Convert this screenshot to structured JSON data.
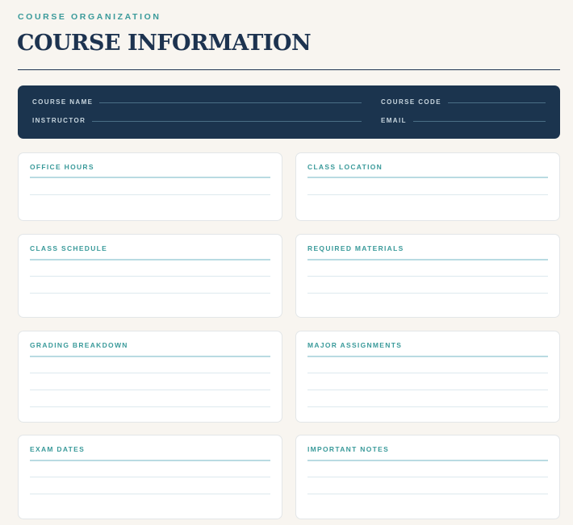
{
  "header": {
    "eyebrow": "COURSE ORGANIZATION",
    "title": "COURSE INFORMATION"
  },
  "banner": {
    "course_name_label": "COURSE NAME",
    "course_code_label": "COURSE CODE",
    "instructor_label": "INSTRUCTOR",
    "email_label": "EMAIL"
  },
  "sections": {
    "office_hours": "OFFICE HOURS",
    "class_location": "CLASS LOCATION",
    "class_schedule": "CLASS SCHEDULE",
    "required_materials": "REQUIRED MATERIALS",
    "grading_breakdown": "GRADING BREAKDOWN",
    "major_assignments": "MAJOR ASSIGNMENTS",
    "exam_dates": "EXAM DATES",
    "important_notes": "IMPORTANT NOTES"
  },
  "colors": {
    "page_bg": "#f8f5f0",
    "navy": "#1b344e",
    "teal_accent": "#3a9a9a"
  }
}
